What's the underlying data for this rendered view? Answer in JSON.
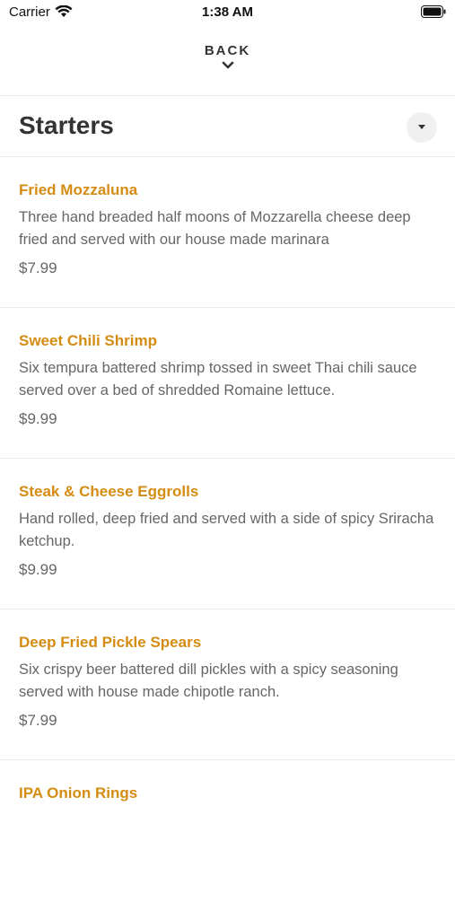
{
  "status_bar": {
    "carrier": "Carrier",
    "time": "1:38 AM"
  },
  "nav": {
    "back_label": "BACK"
  },
  "section": {
    "title": "Starters"
  },
  "menu_items": [
    {
      "name": "Fried Mozzaluna",
      "description": "Three hand breaded half moons of Mozzarella cheese deep fried and served with our house made marinara",
      "price": "$7.99"
    },
    {
      "name": "Sweet Chili Shrimp",
      "description": "Six tempura battered shrimp tossed in sweet Thai chili sauce served over a bed of shredded Romaine lettuce.",
      "price": "$9.99"
    },
    {
      "name": "Steak & Cheese Eggrolls",
      "description": "Hand rolled, deep fried and served with a side of spicy Sriracha ketchup.",
      "price": "$9.99"
    },
    {
      "name": "Deep Fried Pickle Spears",
      "description": "Six crispy beer battered dill pickles with a spicy seasoning served with house made chipotle ranch.",
      "price": "$7.99"
    },
    {
      "name": "IPA Onion Rings",
      "description": "",
      "price": ""
    }
  ],
  "colors": {
    "accent": "#d58c12",
    "text_dark": "#333333",
    "text_muted": "#666666",
    "divider": "#e9e9e9"
  }
}
